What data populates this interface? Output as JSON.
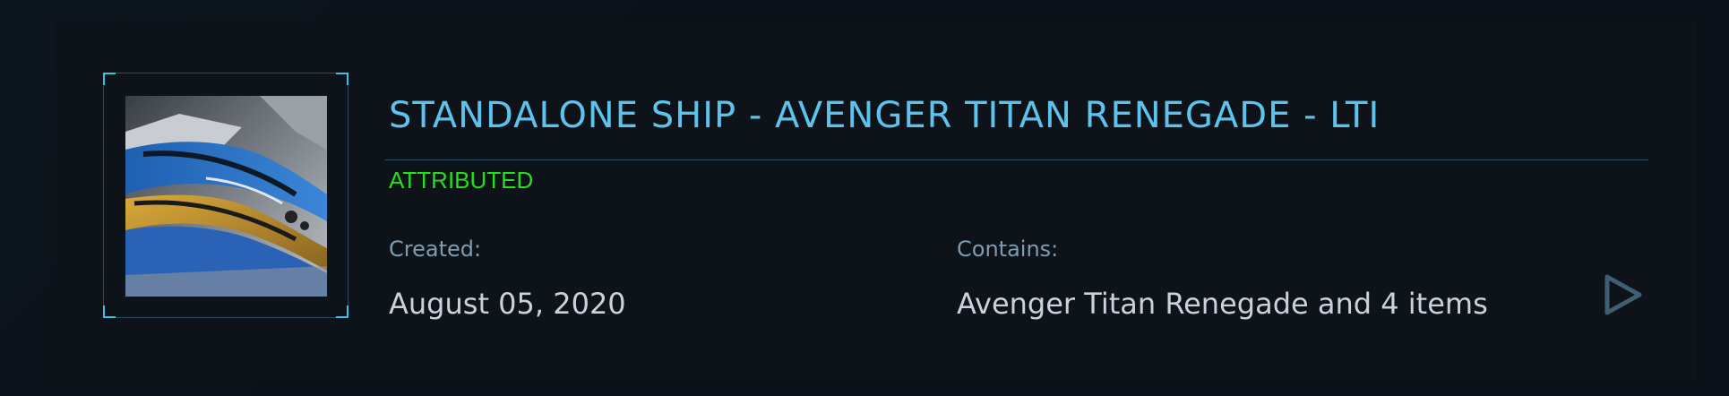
{
  "pledge": {
    "title": "STANDALONE SHIP - AVENGER TITAN RENEGADE - LTI",
    "status": "ATTRIBUTED",
    "created": {
      "label": "Created:",
      "value": "August 05, 2020"
    },
    "contains": {
      "label": "Contains:",
      "value": "Avenger Titan Renegade and 4 items"
    },
    "thumbnail_icon": "ship-thumbnail",
    "expand_icon": "play-triangle-icon"
  },
  "colors": {
    "title": "#5bc3ec",
    "status": "#22e01a",
    "label": "#7f9bb1",
    "value": "#c7d3dc",
    "accent": "#39c3e6"
  }
}
